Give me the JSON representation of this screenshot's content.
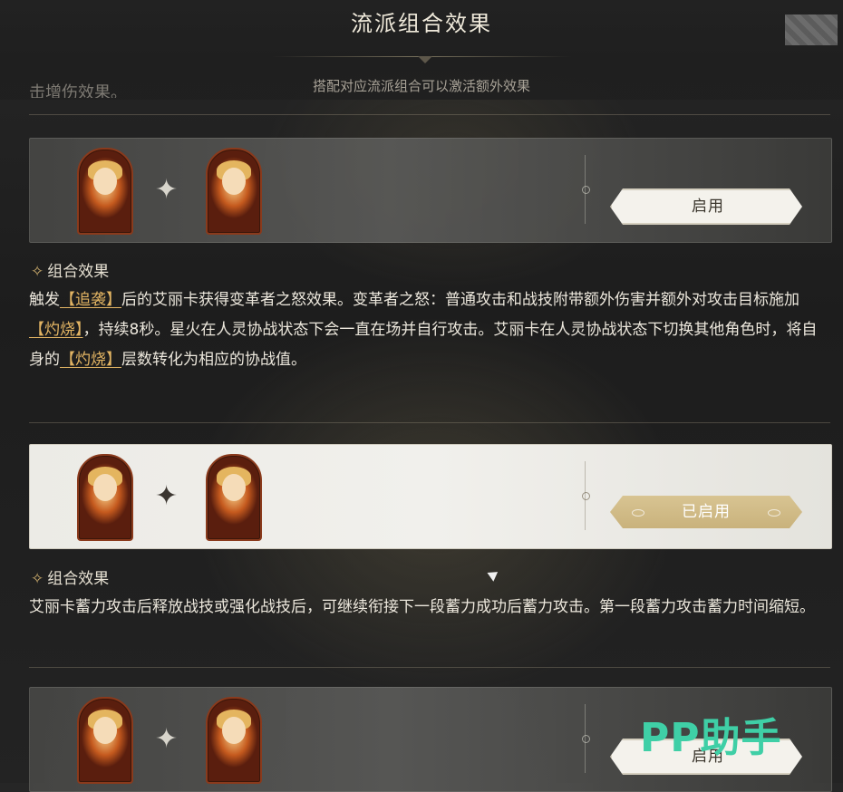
{
  "header": {
    "title": "流派组合效果",
    "subtitle": "搭配对应流派组合可以激活额外效果"
  },
  "cut_text": "击增伤效果。",
  "combos": [
    {
      "button_label": "启用",
      "effect_head": "组合效果",
      "effect_parts": {
        "p1": "触发",
        "h1": "【追袭】",
        "p2": "后的艾丽卡获得变革者之怒效果。变革者之怒：普通攻击和战技附带额外伤害并额外对攻击目标施加",
        "h2": "【灼烧】",
        "p3": "，持续8秒。星火在人灵协战状态下会一直在场并自行攻击。艾丽卡在人灵协战状态下切换其他角色时，将自身的",
        "h3": "【灼烧】",
        "p4": "层数转化为相应的协战值。"
      }
    },
    {
      "button_label": "已启用",
      "effect_head": "组合效果",
      "effect_text": "艾丽卡蓄力攻击后释放战技或强化战技后，可继续衔接下一段蓄力成功后蓄力攻击。第一段蓄力攻击蓄力时间缩短。"
    },
    {
      "button_label": "启用"
    }
  ],
  "watermark": "PP助手"
}
